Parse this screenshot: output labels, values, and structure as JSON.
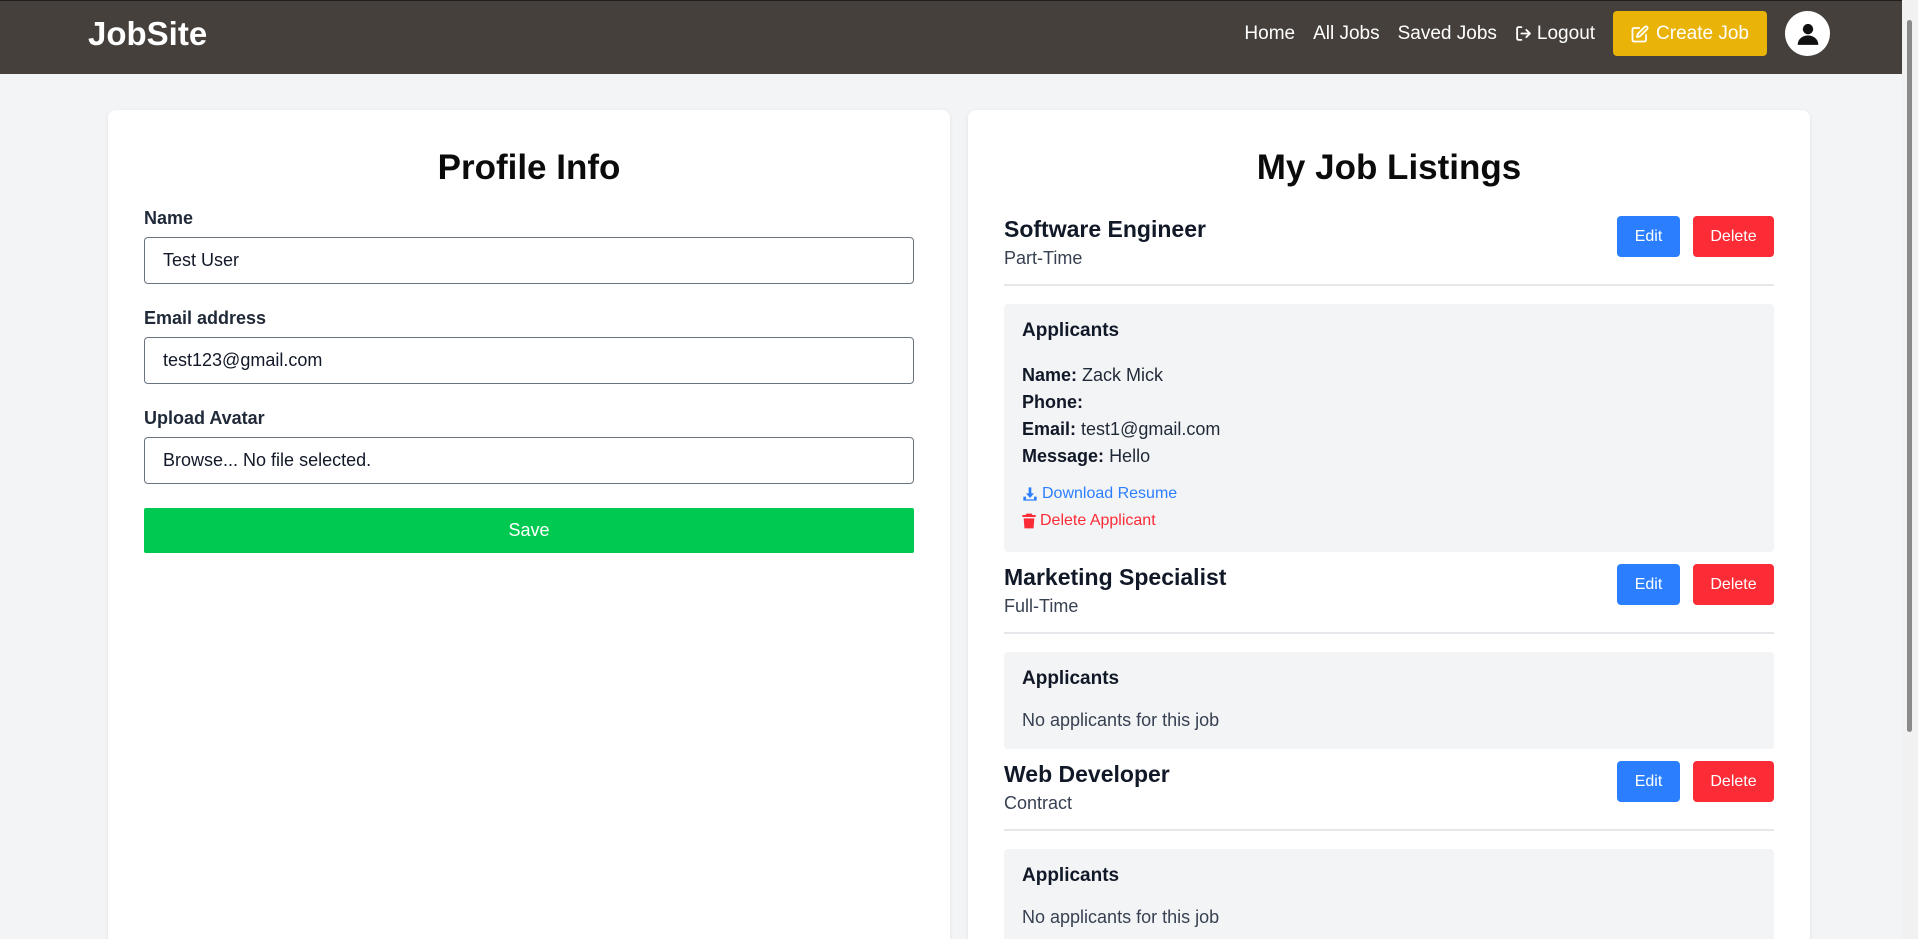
{
  "nav": {
    "brand": "JobSite",
    "links": [
      "Home",
      "All Jobs",
      "Saved Jobs",
      "Logout"
    ],
    "create_job": "Create Job",
    "logout_icon": "logout-icon",
    "create_icon": "edit-square-icon",
    "avatar_icon": "user-icon"
  },
  "profile": {
    "title": "Profile Info",
    "name_label": "Name",
    "name_value": "Test User",
    "email_label": "Email address",
    "email_value": "test123@gmail.com",
    "avatar_label": "Upload Avatar",
    "file_button": "Browse...",
    "file_status": "No file selected.",
    "save": "Save"
  },
  "listings": {
    "title": "My Job Listings",
    "edit_label": "Edit",
    "delete_label": "Delete",
    "applicants_heading": "Applicants",
    "jobs": [
      {
        "title": "Software Engineer",
        "type": "Part-Time",
        "applicants": [
          {
            "name_label": "Name:",
            "name": "Zack Mick",
            "phone_label": "Phone:",
            "phone": "",
            "email_label": "Email:",
            "email": "test1@gmail.com",
            "message_label": "Message:",
            "message": "Hello",
            "download": "Download Resume",
            "delete": "Delete Applicant"
          }
        ]
      },
      {
        "title": "Marketing Specialist",
        "type": "Full-Time",
        "empty": "No applicants for this job"
      },
      {
        "title": "Web Developer",
        "type": "Contract",
        "empty": "No applicants for this job"
      }
    ]
  },
  "colors": {
    "navbar": "#45403b",
    "accent_yellow": "#eab308",
    "save_green": "#00c951",
    "edit_blue": "#2b7fff",
    "delete_red": "#fb2c36"
  }
}
